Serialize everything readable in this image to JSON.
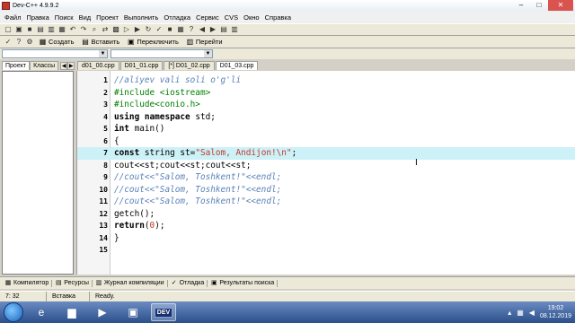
{
  "window": {
    "title": "Dev-C++ 4.9.9.2",
    "controls": [
      "–",
      "□",
      "✕"
    ]
  },
  "menu": [
    "Файл",
    "Правка",
    "Поиск",
    "Вид",
    "Проект",
    "Выполнить",
    "Отладка",
    "Сервис",
    "CVS",
    "Окно",
    "Справка"
  ],
  "toolbar2": {
    "create": "Создать",
    "insert": "Вставить",
    "toggle": "Переключить",
    "goto": "Перейти"
  },
  "left_tabs": {
    "project": "Проект",
    "classes": "Классы"
  },
  "file_tabs": [
    "d01_00.cpp",
    "D01_01.cpp",
    "[*] D01_02.cpp",
    "D01_03.cpp"
  ],
  "code_lines": [
    {
      "n": "1",
      "html": "<span class='cmt'>//aliyev vali soli o'g'li</span>"
    },
    {
      "n": "2",
      "html": "<span class='pp'>#include &lt;iostream&gt;</span>"
    },
    {
      "n": "3",
      "html": "<span class='pp'>#include&lt;conio.h&gt;</span>"
    },
    {
      "n": "4",
      "html": "<span class='kw'>using namespace</span> std;"
    },
    {
      "n": "5",
      "html": "<span class='kw'>int</span> main()"
    },
    {
      "n": "6",
      "html": "{"
    },
    {
      "n": "7",
      "html": "<span class='kw'>const</span> string st=<span class='str'>\"Salom, Andijon!\\n\"</span>;"
    },
    {
      "n": "8",
      "html": "cout&lt;&lt;st;cout&lt;&lt;st;cout&lt;&lt;st;"
    },
    {
      "n": "9",
      "html": "<span class='cmt'>//cout&lt;&lt;\"Salom, Toshkent!\"&lt;&lt;endl;</span>"
    },
    {
      "n": "10",
      "html": "<span class='cmt'>//cout&lt;&lt;\"Salom, Toshkent!\"&lt;&lt;endl;</span>"
    },
    {
      "n": "11",
      "html": "<span class='cmt'>//cout&lt;&lt;\"Salom, Toshkent!\"&lt;&lt;endl;</span>"
    },
    {
      "n": "12",
      "html": "getch();"
    },
    {
      "n": "13",
      "html": "<span class='kw'>return</span>(<span class='num'>0</span>);"
    },
    {
      "n": "14",
      "html": "}"
    },
    {
      "n": "15",
      "html": ""
    }
  ],
  "highlighted_line": 7,
  "bottom_tabs": [
    {
      "icon": "compiler-icon",
      "glyph": "▦",
      "label": "Компилятор"
    },
    {
      "icon": "resources-icon",
      "glyph": "▤",
      "label": "Ресурсы"
    },
    {
      "icon": "compile-log-icon",
      "glyph": "▥",
      "label": "Журнал компиляции"
    },
    {
      "icon": "debug-icon",
      "glyph": "✓",
      "label": "Отладка"
    },
    {
      "icon": "search-results-icon",
      "glyph": "▣",
      "label": "Результаты поиска"
    }
  ],
  "status": {
    "position": "7: 32",
    "mode": "Вставка",
    "state": "Ready."
  },
  "taskbar": {
    "dev_label": "DEV",
    "time": "19:02",
    "date": "08.12.2019"
  }
}
